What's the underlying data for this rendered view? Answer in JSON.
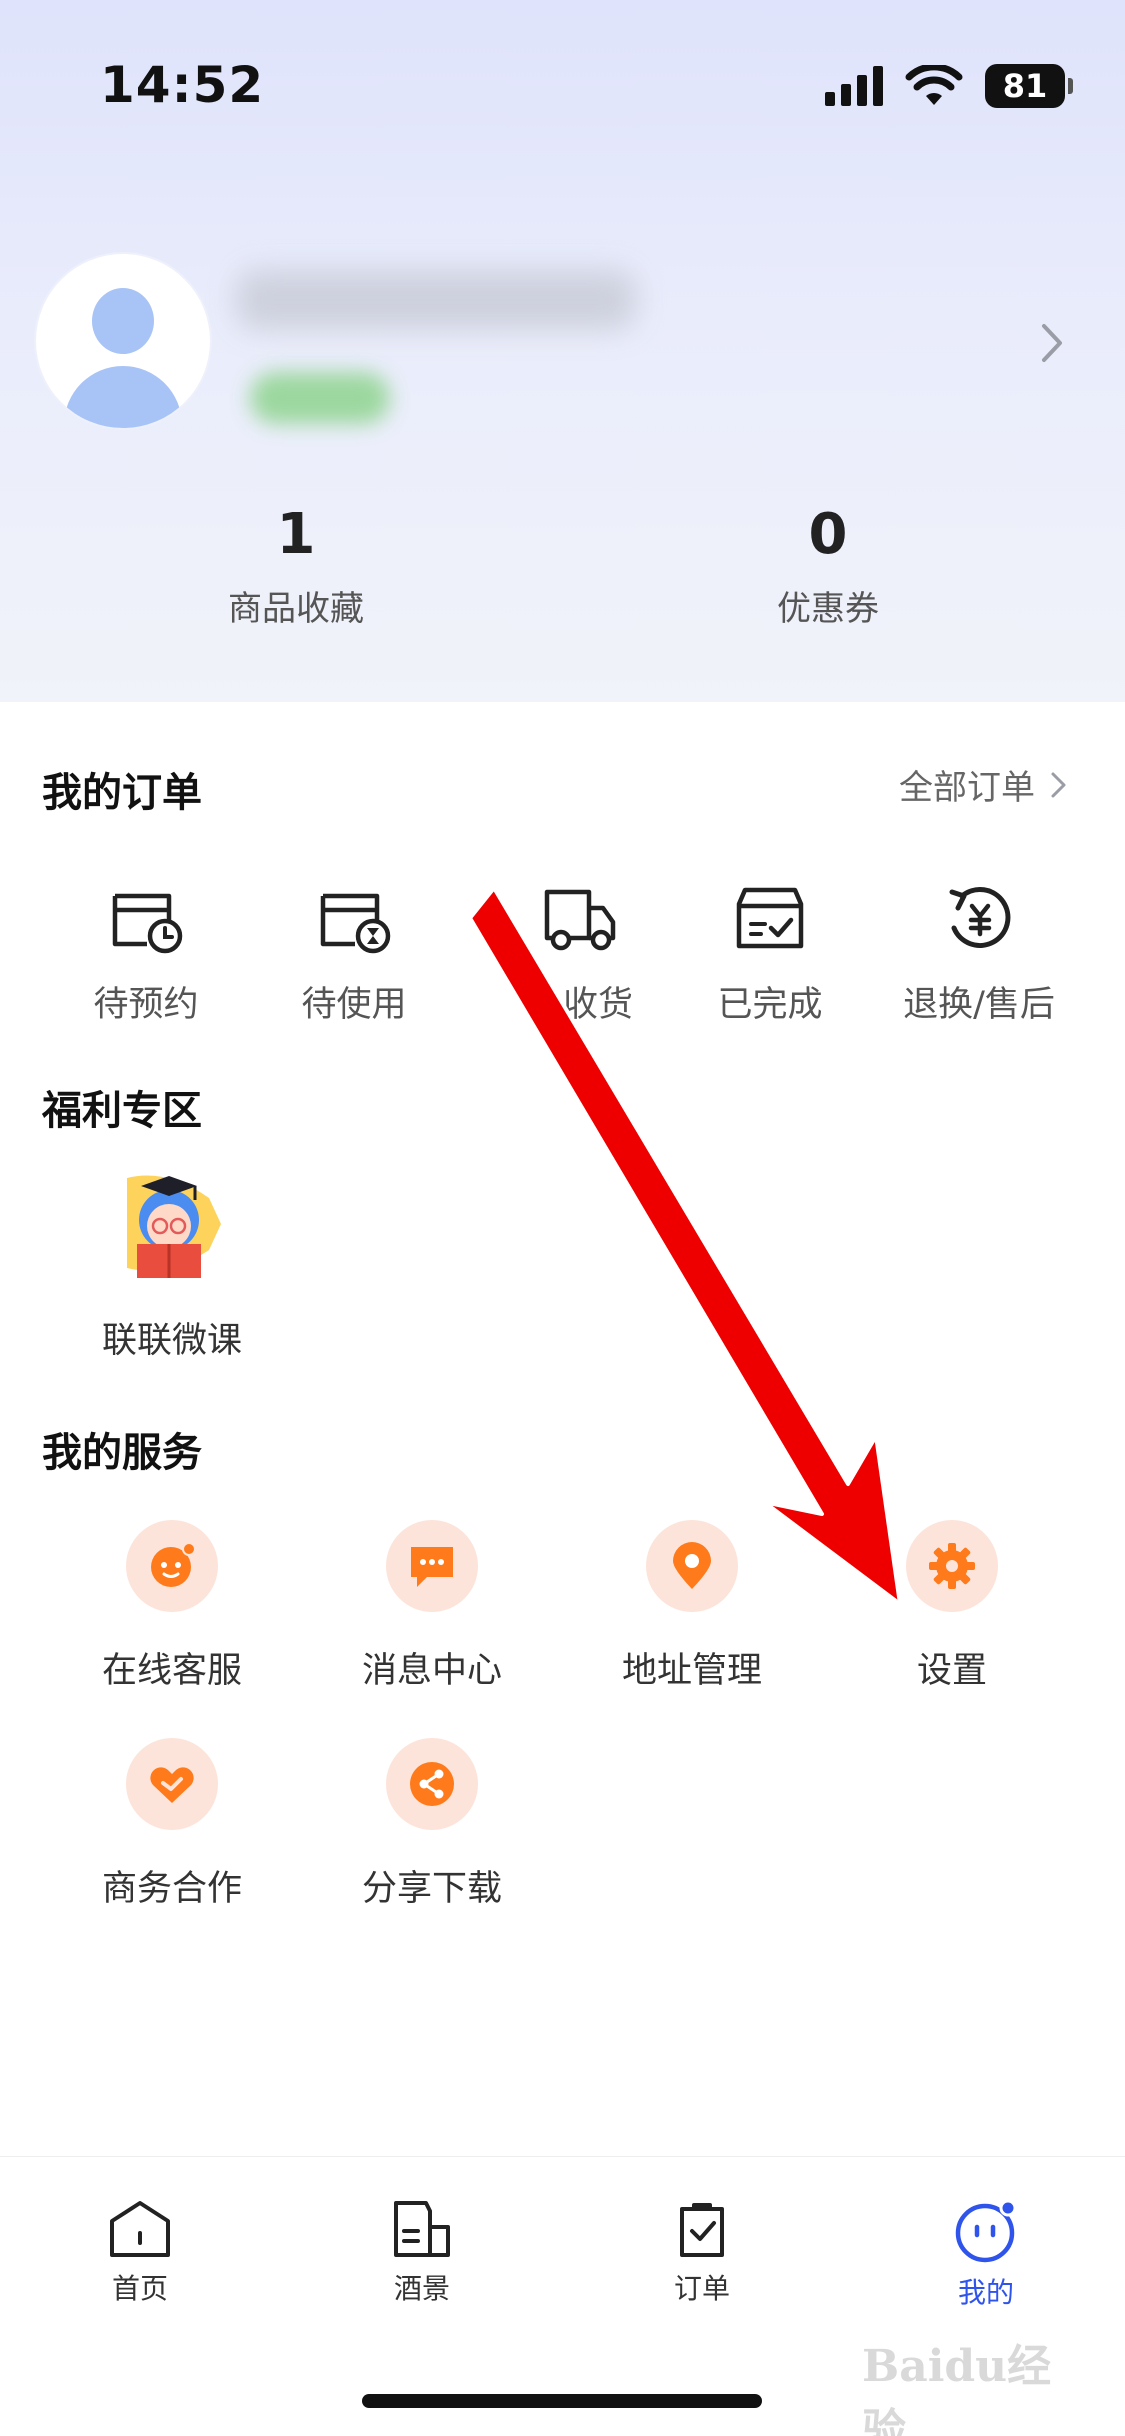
{
  "status_bar": {
    "time": "14:52",
    "battery": "81"
  },
  "profile": {
    "stats": [
      {
        "value": "1",
        "label": "商品收藏"
      },
      {
        "value": "0",
        "label": "优惠券"
      }
    ]
  },
  "orders": {
    "title": "我的订单",
    "all_label": "全部订单",
    "items": [
      {
        "label": "待预约",
        "icon": "calendar-clock-icon"
      },
      {
        "label": "待使用",
        "icon": "calendar-hourglass-icon"
      },
      {
        "label": "收货",
        "icon": "truck-icon"
      },
      {
        "label": "已完成",
        "icon": "box-check-icon"
      },
      {
        "label": "退换/售后",
        "icon": "refund-yuan-icon"
      }
    ]
  },
  "welfare": {
    "title": "福利专区",
    "items": [
      {
        "label": "联联微课",
        "icon": "student-reading-icon"
      }
    ]
  },
  "services": {
    "title": "我的服务",
    "items": [
      {
        "label": "在线客服",
        "icon": "customer-service-icon"
      },
      {
        "label": "消息中心",
        "icon": "message-icon"
      },
      {
        "label": "地址管理",
        "icon": "location-pin-icon"
      },
      {
        "label": "设置",
        "icon": "gear-icon"
      },
      {
        "label": "商务合作",
        "icon": "handshake-icon"
      },
      {
        "label": "分享下载",
        "icon": "share-icon"
      }
    ]
  },
  "tabbar": {
    "items": [
      {
        "label": "首页",
        "icon": "home-icon",
        "active": false
      },
      {
        "label": "酒景",
        "icon": "hotel-icon",
        "active": false
      },
      {
        "label": "订单",
        "icon": "order-bag-icon",
        "active": false
      },
      {
        "label": "我的",
        "icon": "profile-face-icon",
        "active": true
      }
    ]
  },
  "colors": {
    "accent": "#2f54eb",
    "service_icon": "#ff7a1a",
    "service_bg": "#fde4da",
    "arrow": "#ee0000"
  },
  "watermark": "Baidu经验"
}
